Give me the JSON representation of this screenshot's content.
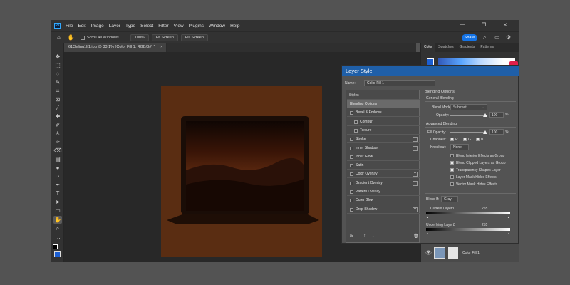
{
  "menubar": {
    "logo": "Ps",
    "items": [
      "File",
      "Edit",
      "Image",
      "Layer",
      "Type",
      "Select",
      "Filter",
      "View",
      "Plugins",
      "Window",
      "Help"
    ],
    "window_controls": [
      "—",
      "❐",
      "✕"
    ]
  },
  "options_bar": {
    "scroll_all_windows": "Scroll All Windows",
    "zoom": "100%",
    "fit_screen": "Fit Screen",
    "fill_screen": "Fill Screen",
    "share": "Share"
  },
  "document": {
    "tab_title": "61Qelinu1lf1.jpg @ 33.1% (Color Fill 1, RGB/8#) *",
    "tab_close": "×"
  },
  "right_panel": {
    "tabs": [
      "Color",
      "Swatches",
      "Gradients",
      "Patterns"
    ],
    "layer_name": "Color Fill 1"
  },
  "dialog": {
    "title": "Layer Style",
    "name_label": "Name:",
    "name_value": "Color Fill 1",
    "styles_header": "Styles",
    "styles": [
      {
        "label": "Blending Options",
        "checkbox": false,
        "plus": false,
        "selected": true,
        "sub": false
      },
      {
        "label": "Bevel & Emboss",
        "checkbox": true,
        "plus": false,
        "selected": false,
        "sub": false
      },
      {
        "label": "Contour",
        "checkbox": true,
        "plus": false,
        "selected": false,
        "sub": true
      },
      {
        "label": "Texture",
        "checkbox": true,
        "plus": false,
        "selected": false,
        "sub": true
      },
      {
        "label": "Stroke",
        "checkbox": true,
        "plus": true,
        "selected": false,
        "sub": false
      },
      {
        "label": "Inner Shadow",
        "checkbox": true,
        "plus": true,
        "selected": false,
        "sub": false
      },
      {
        "label": "Inner Glow",
        "checkbox": true,
        "plus": false,
        "selected": false,
        "sub": false
      },
      {
        "label": "Satin",
        "checkbox": true,
        "plus": false,
        "selected": false,
        "sub": false
      },
      {
        "label": "Color Overlay",
        "checkbox": true,
        "plus": true,
        "selected": false,
        "sub": false
      },
      {
        "label": "Gradient Overlay",
        "checkbox": true,
        "plus": true,
        "selected": false,
        "sub": false
      },
      {
        "label": "Pattern Overlay",
        "checkbox": true,
        "plus": false,
        "selected": false,
        "sub": false
      },
      {
        "label": "Outer Glow",
        "checkbox": true,
        "plus": false,
        "selected": false,
        "sub": false
      },
      {
        "label": "Drop Shadow",
        "checkbox": true,
        "plus": true,
        "selected": false,
        "sub": false
      }
    ],
    "footer_fx": "fx",
    "blending_options": "Blending Options",
    "general_blending": "General Blending",
    "blend_mode_label": "Blend Mode:",
    "blend_mode_value": "Subtract",
    "opacity_label": "Opacity:",
    "opacity_value": "100",
    "percent": "%",
    "advanced_blending": "Advanced Blending",
    "fill_opacity_label": "Fill Opacity:",
    "fill_opacity_value": "100",
    "channels_label": "Channels:",
    "channel_r": "R",
    "channel_g": "G",
    "channel_b": "B",
    "knockout_label": "Knockout:",
    "knockout_value": "None",
    "advanced_options": [
      {
        "label": "Blend Interior Effects as Group",
        "checked": false
      },
      {
        "label": "Blend Clipped Layers as Group",
        "checked": true
      },
      {
        "label": "Transparency Shapes Layer",
        "checked": true
      },
      {
        "label": "Layer Mask Hides Effects",
        "checked": false
      },
      {
        "label": "Vector Mask Hides Effects",
        "checked": false
      }
    ],
    "blend_if_label": "Blend If:",
    "blend_if_value": "Gray",
    "current_layer_label": "Current Layer:",
    "current_low": "0",
    "current_high": "255",
    "underlying_label": "Underlying Layer:",
    "underlying_low": "0",
    "underlying_high": "255"
  },
  "colors": {
    "dialog_title_bg": "#1f5fa8",
    "share_bg": "#1473e6",
    "artboard": "#5a2d12",
    "canvas_bg": "#282828"
  }
}
